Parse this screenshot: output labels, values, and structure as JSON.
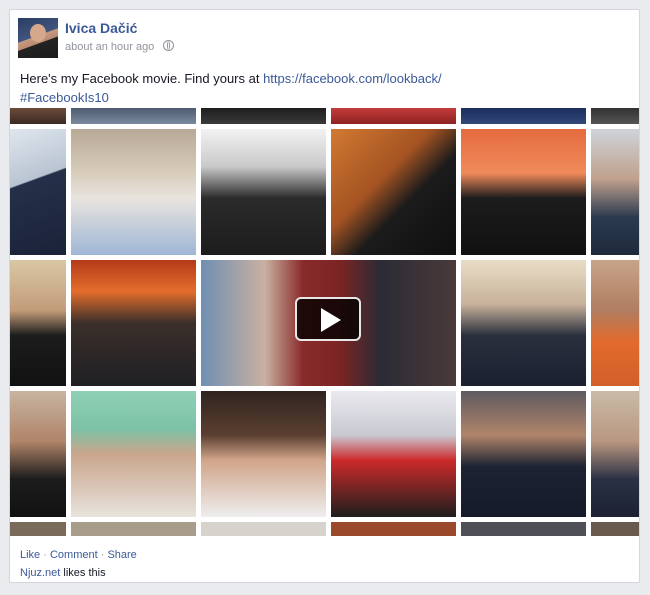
{
  "post": {
    "author": "Ivica Dačić",
    "timestamp": "about an hour ago",
    "privacy_icon": "globe-icon",
    "message_prefix": "Here's my Facebook movie. Find yours at ",
    "message_link": "https://facebook.com/lookback/",
    "hashtag": "#FacebookIs10"
  },
  "collage": {
    "video_control": "play-icon"
  },
  "actions": {
    "like": "Like",
    "comment": "Comment",
    "share": "Share",
    "separator": " · "
  },
  "likes": {
    "page_name": "Njuz.net",
    "suffix": " likes this"
  }
}
